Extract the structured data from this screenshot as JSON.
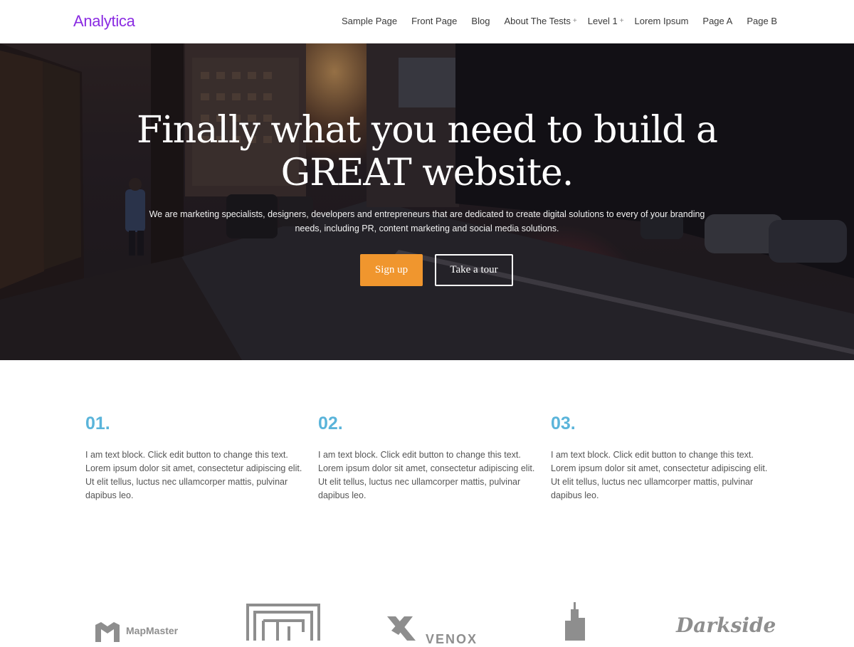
{
  "header": {
    "brand": "Analytica",
    "nav": [
      {
        "label": "Sample Page",
        "has_children": false
      },
      {
        "label": "Front Page",
        "has_children": false
      },
      {
        "label": "Blog",
        "has_children": false
      },
      {
        "label": "About The Tests",
        "has_children": true
      },
      {
        "label": "Level 1",
        "has_children": true
      },
      {
        "label": "Lorem Ipsum",
        "has_children": false
      },
      {
        "label": "Page A",
        "has_children": false
      },
      {
        "label": "Page B",
        "has_children": false
      }
    ],
    "submenu_indicator": "+"
  },
  "hero": {
    "title": "Finally what you need to build a GREAT website.",
    "subtitle": "We are marketing specialists, designers, developers and entrepreneurs that are dedicated to create digital solutions to every of your branding needs, including PR, content marketing and social media solutions.",
    "primary_button": "Sign up",
    "secondary_button": "Take a tour"
  },
  "features": [
    {
      "number": "01.",
      "text": "I am text block. Click edit button to change this text. Lorem ipsum dolor sit amet, consectetur adipiscing elit. Ut elit tellus, luctus nec ullamcorper mattis, pulvinar dapibus leo."
    },
    {
      "number": "02.",
      "text": "I am text block. Click edit button to change this text. Lorem ipsum dolor sit amet, consectetur adipiscing elit. Ut elit tellus, luctus nec ullamcorper mattis, pulvinar dapibus leo."
    },
    {
      "number": "03.",
      "text": "I am text block. Click edit button to change this text. Lorem ipsum dolor sit amet, consectetur adipiscing elit. Ut elit tellus, luctus nec ullamcorper mattis, pulvinar dapibus leo."
    }
  ],
  "client_logos": {
    "mapmaster": "MapMaster",
    "venox": "VENOX",
    "darkside": "Darkside"
  },
  "colors": {
    "brand": "#8a2be2",
    "accent_orange": "#f0962e",
    "feature_number": "#5ab4da",
    "logo_gray": "#8e8e8e"
  }
}
